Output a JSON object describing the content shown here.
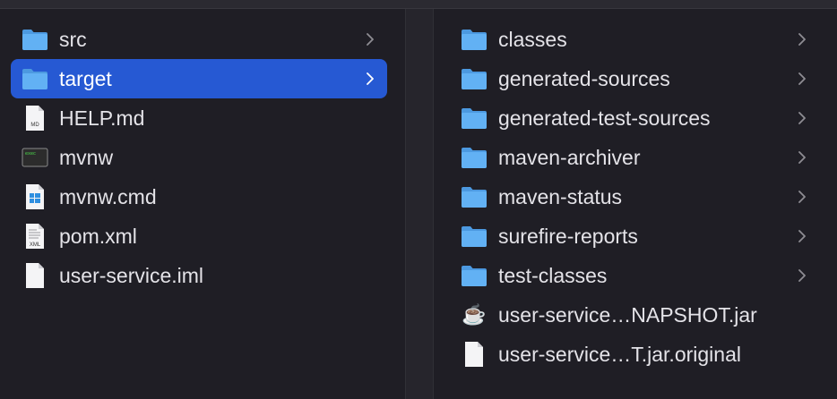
{
  "left_column": {
    "items": [
      {
        "label": "src",
        "kind": "folder",
        "expandable": true,
        "selected": false,
        "icon": "folder-icon"
      },
      {
        "label": "target",
        "kind": "folder",
        "expandable": true,
        "selected": true,
        "icon": "folder-icon"
      },
      {
        "label": "HELP.md",
        "kind": "markdown-file",
        "expandable": false,
        "selected": false,
        "icon": "markdown-file-icon",
        "icon_text": "MD"
      },
      {
        "label": "mvnw",
        "kind": "executable",
        "expandable": false,
        "selected": false,
        "icon": "terminal-executable-icon",
        "icon_text": "exec"
      },
      {
        "label": "mvnw.cmd",
        "kind": "windows-cmd",
        "expandable": false,
        "selected": false,
        "icon": "windows-cmd-file-icon"
      },
      {
        "label": "pom.xml",
        "kind": "xml-file",
        "expandable": false,
        "selected": false,
        "icon": "xml-file-icon",
        "icon_text": "XML"
      },
      {
        "label": "user-service.iml",
        "kind": "file",
        "expandable": false,
        "selected": false,
        "icon": "blank-file-icon"
      }
    ]
  },
  "right_column": {
    "items": [
      {
        "label": "classes",
        "kind": "folder",
        "expandable": true,
        "icon": "folder-icon"
      },
      {
        "label": "generated-sources",
        "kind": "folder",
        "expandable": true,
        "icon": "folder-icon"
      },
      {
        "label": "generated-test-sources",
        "kind": "folder",
        "expandable": true,
        "icon": "folder-icon"
      },
      {
        "label": "maven-archiver",
        "kind": "folder",
        "expandable": true,
        "icon": "folder-icon"
      },
      {
        "label": "maven-status",
        "kind": "folder",
        "expandable": true,
        "icon": "folder-icon"
      },
      {
        "label": "surefire-reports",
        "kind": "folder",
        "expandable": true,
        "icon": "folder-icon"
      },
      {
        "label": "test-classes",
        "kind": "folder",
        "expandable": true,
        "icon": "folder-icon"
      },
      {
        "label": "user-service…NAPSHOT.jar",
        "kind": "jar",
        "expandable": false,
        "icon": "java-jar-icon",
        "icon_glyph": "☕"
      },
      {
        "label": "user-service…T.jar.original",
        "kind": "file",
        "expandable": false,
        "icon": "blank-file-icon"
      }
    ]
  },
  "colors": {
    "background": "#1f1e25",
    "selection": "#2659d3",
    "folder": "#5aa9f0",
    "text": "#e4e3e8",
    "chevron": "#8e8d93"
  }
}
